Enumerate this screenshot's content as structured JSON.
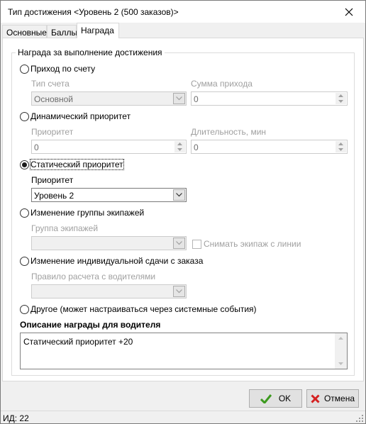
{
  "window": {
    "title": "Тип достижения <Уровень 2 (500 заказов)>",
    "close_icon": "close-icon"
  },
  "tabs": [
    {
      "label": "Основные",
      "active": false
    },
    {
      "label": "Баллы",
      "active": false
    },
    {
      "label": "Награда",
      "active": true
    }
  ],
  "group": {
    "title": "Награда за выполнение достижения"
  },
  "options": {
    "account_income": {
      "label": "Приход по счету",
      "checked": false,
      "account_type_label": "Тип счета",
      "account_type_value": "Основной",
      "amount_label": "Сумма прихода",
      "amount_value": "0"
    },
    "dynamic_priority": {
      "label": "Динамический приоритет",
      "checked": false,
      "priority_label": "Приоритет",
      "priority_value": "0",
      "duration_label": "Длительность, мин",
      "duration_value": "0"
    },
    "static_priority": {
      "label": "Статический приоритет",
      "checked": true,
      "priority_label": "Приоритет",
      "priority_value": "Уровень 2"
    },
    "crew_group": {
      "label": "Изменение группы экипажей",
      "checked": false,
      "group_label": "Группа экипажей",
      "group_value": "",
      "remove_crew_label": "Снимать экипаж с линии",
      "remove_crew_checked": false
    },
    "individual_fee": {
      "label": "Изменение индивидуальной сдачи с заказа",
      "checked": false,
      "rule_label": "Правило расчета с водителями",
      "rule_value": ""
    },
    "other": {
      "label": "Другое (может настраиваться через системные события)",
      "checked": false
    }
  },
  "description": {
    "title": "Описание награды для водителя",
    "text": "Статический приоритет +20"
  },
  "buttons": {
    "ok": "OK",
    "cancel": "Отмена"
  },
  "status": {
    "id_text": "ИД: 22"
  },
  "colors": {
    "ok_check": "#3c9a1e",
    "cancel_x": "#d42020",
    "disabled_text": "#a0a0a0"
  }
}
